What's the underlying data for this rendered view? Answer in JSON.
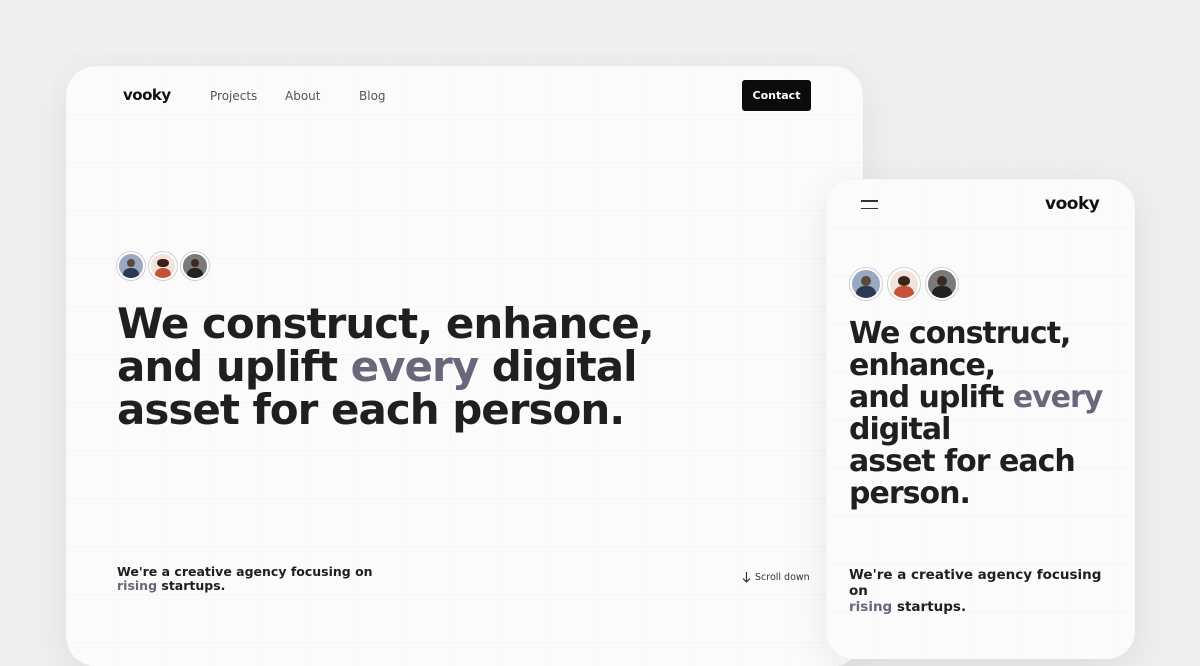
{
  "brand": {
    "name": "vooky"
  },
  "nav": {
    "items": [
      "Projects",
      "About",
      "Blog"
    ],
    "contact_label": "Contact"
  },
  "hero": {
    "headline_part1": "We construct, enhance,",
    "headline_part2": "and uplift ",
    "headline_accent": "every",
    "headline_part3": " digital",
    "headline_part4": "asset for each person.",
    "tagline_main": "We're a creative agency focusing on",
    "tagline_accent": "rising",
    "tagline_end": " startups.",
    "scroll_label": "Scroll down"
  },
  "mobile": {
    "headline_line1": "We construct,",
    "headline_line2": "enhance,",
    "headline_line3a": "and uplift ",
    "headline_line3b": "every",
    "headline_line4": "digital",
    "headline_line5": "asset for each",
    "headline_line6": "person.",
    "tagline_line1": "We're a creative agency focusing",
    "tagline_line2": "on"
  },
  "icons": {
    "menu": "hamburger-menu-icon",
    "scroll": "arrow-down-icon"
  },
  "colors": {
    "accent": "#6b6679",
    "button_bg": "#0b0b0b",
    "text": "#1f1f1f",
    "card_bg": "#fbfbfb"
  }
}
